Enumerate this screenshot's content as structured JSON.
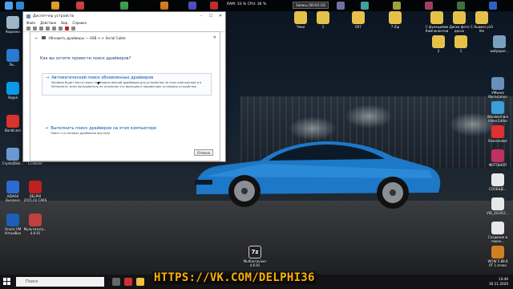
{
  "desktop": {
    "left_icons": [
      {
        "label": "Корзина",
        "icon": "recycle-bin-icon",
        "color": "#9fb7c9"
      },
      {
        "label": "uTorrent Web",
        "icon": "utorrent-icon",
        "color": "#5fb630"
      },
      {
        "label": "Ли...",
        "icon": "app-icon",
        "color": "#2a7ad1"
      },
      {
        "label": "Telegram",
        "icon": "telegram-icon",
        "color": "#2aa3e0"
      },
      {
        "label": "Skype",
        "icon": "skype-icon",
        "color": "#0a9be8"
      },
      {
        "label": "WhatsApp",
        "icon": "whatsapp-icon",
        "color": "#2bcf5b"
      },
      {
        "label": "Bandicam",
        "icon": "bandicam-icon",
        "color": "#d9342b"
      },
      {
        "label": "UltraISO",
        "icon": "ultraiso-icon",
        "color": "#3a6fd8"
      },
      {
        "label": "CrystalDisk...",
        "icon": "crystaldisk-icon",
        "color": "#6a9ad3"
      },
      {
        "label": "CCleaner",
        "icon": "ccleaner-icon",
        "color": "#3a7bd5"
      },
      {
        "label": "AIDA64 Business",
        "icon": "aida64-icon",
        "color": "#2d6bd3"
      },
      {
        "label": "DELPHI 2015.03 CARS",
        "icon": "delphi-icon",
        "color": "#c02020"
      },
      {
        "label": "Oracle VM VirtualBox",
        "icon": "virtualbox-icon",
        "color": "#1d5fb8"
      },
      {
        "label": "Мультизагр... 4.6.91",
        "icon": "multiboot-icon",
        "color": "#c04040"
      }
    ],
    "top_icons": [
      {
        "label": "Чеки",
        "color": "#e6c14a"
      },
      {
        "label": "1",
        "color": "#e6c14a"
      },
      {
        "label": "007",
        "color": "#e6c14a"
      },
      {
        "label": "7-Zip",
        "color": "#e6c14a"
      },
      {
        "label": "С функциями Кампонентов",
        "color": "#e6c14a"
      },
      {
        "label": "Диски фото досок",
        "color": "#e6c14a"
      },
      {
        "label": "С Huawei p10 lite",
        "color": "#e6c14a"
      },
      {
        "label": "2",
        "color": "#e6c14a"
      },
      {
        "label": "1",
        "color": "#e6c14a"
      },
      {
        "label": "wallpaper...",
        "color": "#7aa0c0"
      }
    ],
    "right_icons": [
      {
        "label": "VMware Workstation",
        "color": "#6a8fb8"
      },
      {
        "label": "Wondershare Video Editor",
        "color": "#3a9fd8"
      },
      {
        "label": "Sharemaker",
        "color": "#e03030"
      },
      {
        "label": "ФОТОШОП",
        "color": "#c03060"
      },
      {
        "label": "СООБЩЕ...",
        "color": "#e8e8e8"
      },
      {
        "label": "VID_201911...",
        "color": "#e8e8e8"
      },
      {
        "label": "Создание и поиск...",
        "color": "#e8e8e8"
      },
      {
        "label": "WOW 5.88.8 RT 1 сезон",
        "color": "#d08020"
      }
    ],
    "bottom_center_icon": {
      "label": "Multiarcaviuer 4.6.91",
      "glyph": "7z"
    }
  },
  "top_bar": {
    "perf_text": "RAM: 33 %   CPU: 36 %",
    "rec_text": "Запись [00:05:10]"
  },
  "window": {
    "title": "Диспетчер устройств",
    "menu": [
      "Файл",
      "Действие",
      "Вид",
      "Справка"
    ],
    "dialog": {
      "header": "Обновить драйверы — USB <-> Serial Cable",
      "question": "Как вы хотите провести поиск драйверов?",
      "option1_title": "Автоматический поиск обновленных драйверов",
      "option1_desc": "Windows будет вести поиск последних версий драйверов для устройства на этом компьютере и в Интернете, если пользователь не отключил эту функцию в параметрах установки устройства.",
      "option2_title": "Выполнить поиск драйверов на этом компьютере",
      "option2_desc": "Поиск и установка драйверов вручную.",
      "cancel_label": "Отмена"
    }
  },
  "taskbar": {
    "search_placeholder": "Поиск",
    "time": "14:46",
    "date": "30.11.2020"
  },
  "watermark": "HTTPS://VK.COM/DELPHI36"
}
